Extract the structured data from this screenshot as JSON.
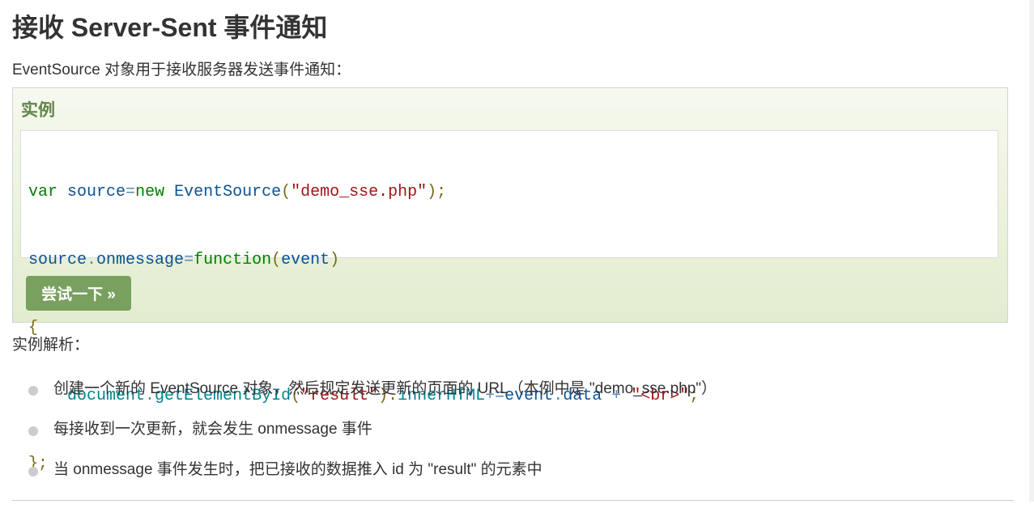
{
  "page": {
    "title": "接收 Server-Sent 事件通知",
    "intro": "EventSource 对象用于接收服务器发送事件通知："
  },
  "example": {
    "heading": "实例",
    "code_lines": [
      "var source=new EventSource(\"demo_sse.php\");",
      "source.onmessage=function(event)",
      "{",
      "    document.getElementById(\"result\").innerHTML+=event.data + \"<br>\";",
      "};"
    ],
    "try_button": "尝试一下 »"
  },
  "analysis": {
    "heading": "实例解析：",
    "points": [
      "创建一个新的 EventSource 对象，然后规定发送更新的页面的 URL（本例中是 \"demo_sse.php\"）",
      "每接收到一次更新，就会发生 onmessage 事件",
      "当 onmessage 事件发生时，把已接收的数据推入 id 为 \"result\" 的元素中"
    ]
  },
  "colors": {
    "example_heading": "#64854c",
    "button_bg": "#7aa05f",
    "keyword": "#008000",
    "identifier": "#0b5394",
    "string": "#a31515"
  }
}
